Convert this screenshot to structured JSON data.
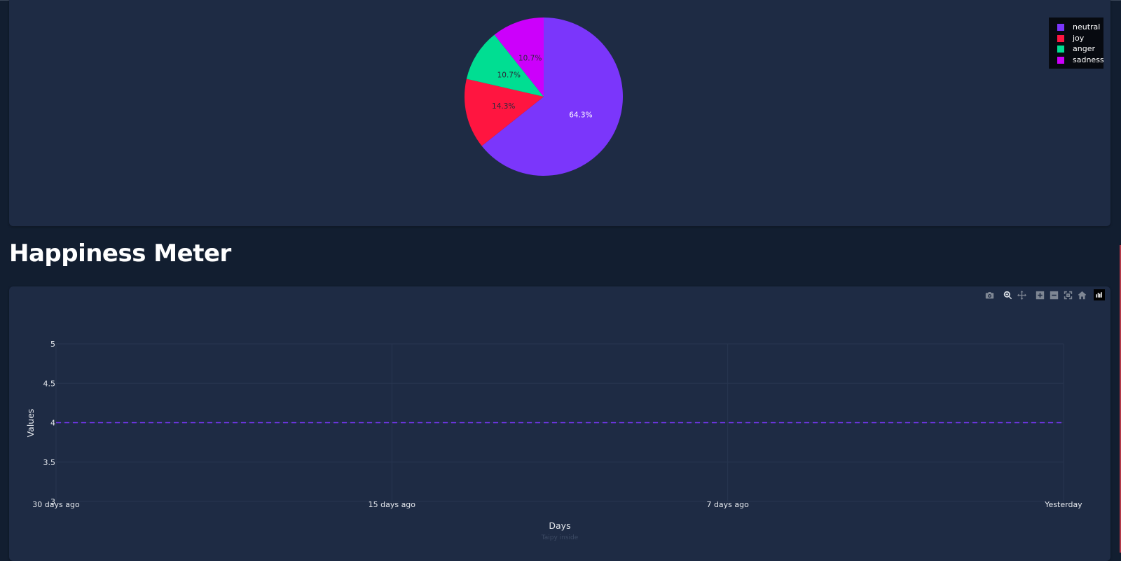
{
  "section_title": "Happiness Meter",
  "pie_legend": [
    {
      "label": "neutral",
      "color": "#7b36fb"
    },
    {
      "label": "joy",
      "color": "#ff1540"
    },
    {
      "label": "anger",
      "color": "#00de92"
    },
    {
      "label": "sadness",
      "color": "#cc00fb"
    }
  ],
  "modebar": {
    "icons": [
      "camera-icon",
      "zoom-icon",
      "pan-icon",
      "zoom-in-icon",
      "zoom-out-icon",
      "autoscale-icon",
      "reset-axes-icon",
      "plotly-logo-icon"
    ]
  },
  "watermark": "Taipy inside",
  "colors": {
    "page_bg": "#121e30",
    "card_bg": "#1e2b44",
    "line": "#7b36fb"
  },
  "chart_data": [
    {
      "type": "pie",
      "labels": [
        "neutral",
        "joy",
        "anger",
        "sadness"
      ],
      "values": [
        64.3,
        14.3,
        10.7,
        10.7
      ],
      "text_labels": [
        "64.3%",
        "14.3%",
        "10.7%",
        "10.7%"
      ],
      "colors": [
        "#7b36fb",
        "#ff1540",
        "#00de92",
        "#cc00fb"
      ],
      "legend_position": "top-right"
    },
    {
      "type": "line",
      "x": [
        "30 days ago",
        "15 days ago",
        "7 days ago",
        "Yesterday"
      ],
      "y": [
        4,
        4,
        4,
        4
      ],
      "xlabel": "Days",
      "ylabel": "Values",
      "ylim": [
        3,
        5
      ],
      "yticks": [
        "3",
        "3.5",
        "4",
        "4.5",
        "5"
      ],
      "line_style": "dashed",
      "color": "#7b36fb",
      "grid": true
    }
  ]
}
